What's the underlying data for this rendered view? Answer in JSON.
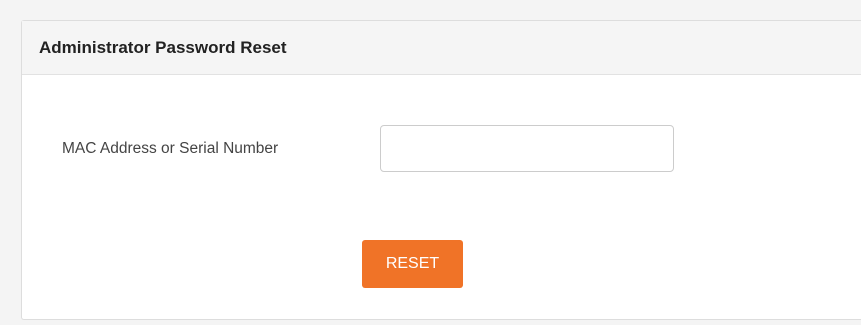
{
  "panel": {
    "title": "Administrator Password Reset"
  },
  "form": {
    "field_label": "MAC Address or Serial Number",
    "field_value": "",
    "reset_label": "RESET"
  },
  "colors": {
    "accent": "#f07327",
    "header_bg": "#f5f5f5",
    "page_bg": "#f4f4f4"
  }
}
